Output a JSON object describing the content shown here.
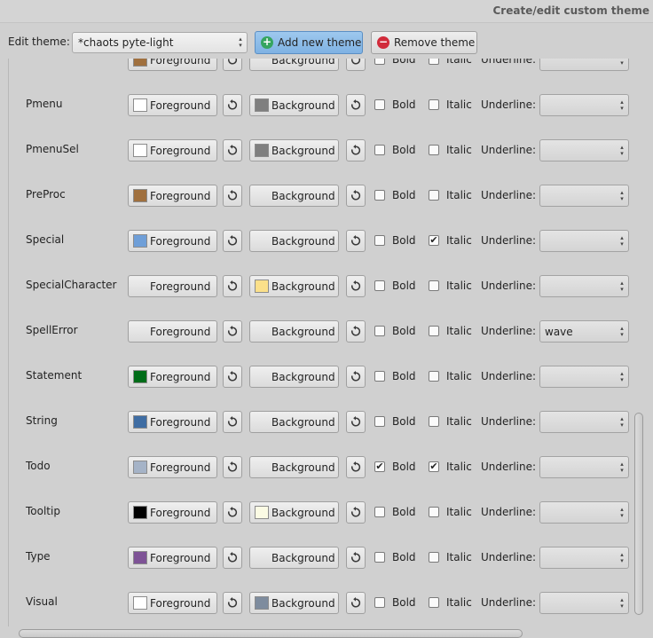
{
  "window": {
    "title": "Create/edit custom theme"
  },
  "toolbar": {
    "edit_theme_label": "Edit theme:",
    "theme_value": "*chaots pyte-light",
    "add_label": "Add new theme",
    "remove_label": "Remove theme"
  },
  "labels": {
    "foreground": "Foreground",
    "background": "Background",
    "bold": "Bold",
    "italic": "Italic",
    "underline": "Underline:"
  },
  "rows": [
    {
      "name": "",
      "fg": "#a0703e",
      "bg": null,
      "bold": false,
      "italic": false,
      "underline": ""
    },
    {
      "name": "Pmenu",
      "fg": "#ffffff",
      "bg": "#7f7f7f",
      "bold": false,
      "italic": false,
      "underline": ""
    },
    {
      "name": "PmenuSel",
      "fg": "#ffffff",
      "bg": "#7f7f7f",
      "bold": false,
      "italic": false,
      "underline": ""
    },
    {
      "name": "PreProc",
      "fg": "#a0703e",
      "bg": null,
      "bold": false,
      "italic": false,
      "underline": ""
    },
    {
      "name": "Special",
      "fg": "#6f9fd8",
      "bg": null,
      "bold": false,
      "italic": true,
      "underline": ""
    },
    {
      "name": "SpecialCharacter",
      "fg": null,
      "bg": "#fbe08a",
      "bold": false,
      "italic": false,
      "underline": ""
    },
    {
      "name": "SpellError",
      "fg": null,
      "bg": null,
      "bold": false,
      "italic": false,
      "underline": "wave"
    },
    {
      "name": "Statement",
      "fg": "#006c18",
      "bg": null,
      "bold": false,
      "italic": false,
      "underline": ""
    },
    {
      "name": "String",
      "fg": "#3f6da3",
      "bg": null,
      "bold": false,
      "italic": false,
      "underline": ""
    },
    {
      "name": "Todo",
      "fg": "#a5b3c7",
      "bg": null,
      "bold": true,
      "italic": true,
      "underline": ""
    },
    {
      "name": "Tooltip",
      "fg": "#000000",
      "bg": "#fbfbe4",
      "bold": false,
      "italic": false,
      "underline": ""
    },
    {
      "name": "Type",
      "fg": "#7e5396",
      "bg": null,
      "bold": false,
      "italic": false,
      "underline": ""
    },
    {
      "name": "Visual",
      "fg": "#ffffff",
      "bg": "#7e8c9e",
      "bold": false,
      "italic": false,
      "underline": ""
    }
  ]
}
